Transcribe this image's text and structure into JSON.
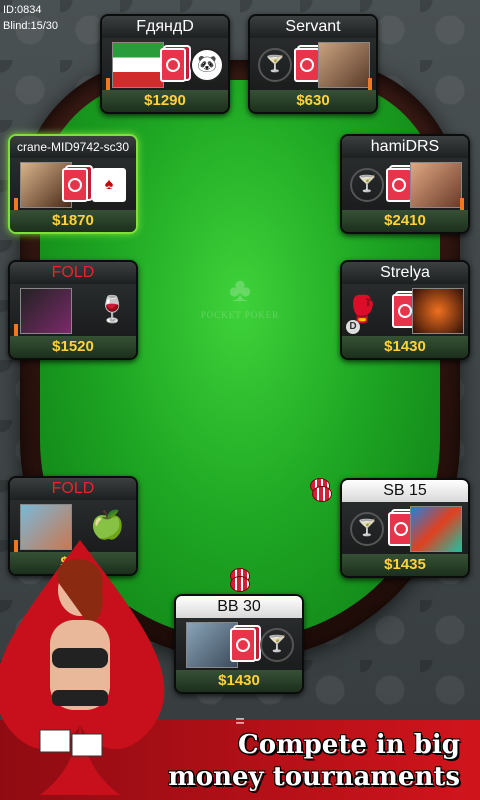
{
  "hud": {
    "id": "ID:0834",
    "blind": "Blind:15/30"
  },
  "table_logo": {
    "text": "POCKET POKER"
  },
  "seats": [
    {
      "name": "FдяндD",
      "stack": "$1290"
    },
    {
      "name": "Servant",
      "stack": "$630"
    },
    {
      "name": "crane-MID9742-sc30",
      "stack": "$1870"
    },
    {
      "name": "hamiDRS",
      "stack": "$2410"
    },
    {
      "name": "FOLD",
      "stack": "$1520"
    },
    {
      "name": "Strelya",
      "stack": "$1430",
      "dealer": "D"
    },
    {
      "name": "FOLD",
      "stack": "$14"
    },
    {
      "name": "SB 15",
      "stack": "$1435"
    },
    {
      "name": "BB 30",
      "stack": "$1430"
    }
  ],
  "menu": {
    "label": "="
  },
  "promo": {
    "line1": "Compete in big",
    "line2": "money tournaments"
  },
  "colors": {
    "felt": "#1fa824",
    "stack": "#ffd23a",
    "fold": "#e8242c",
    "active": "#7fe03a",
    "promo": "#d1141c"
  }
}
